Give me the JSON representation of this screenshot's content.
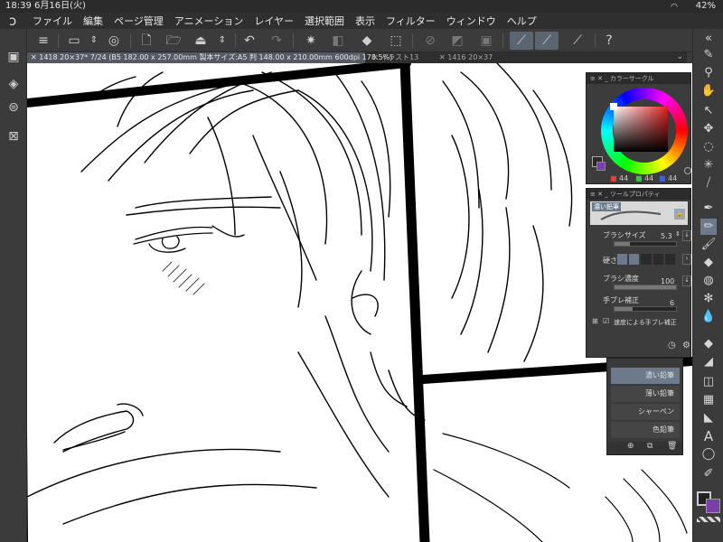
{
  "statusbar": {
    "time": "18:39",
    "date": "6月16日(火)",
    "battery": "42%"
  },
  "menu": [
    "ファイル",
    "編集",
    "ページ管理",
    "アニメーション",
    "レイヤー",
    "選択範囲",
    "表示",
    "フィルター",
    "ウィンドウ",
    "ヘルプ"
  ],
  "tabs": [
    "✕ 1418 20×37* 7/24 (B5 182.00 x 257.00mm 製本サイズ:A5 判 148.00 x 210.00mm 600dpi 178.5%)",
    "✕ イラスト13",
    "✕ 1416 20×37"
  ],
  "colorpanel": {
    "title": "カラーサークル",
    "r": "44",
    "g": "44",
    "b": "44"
  },
  "toolprop": {
    "title": "ツールプロパティ",
    "brush_name": "濃い鉛筆",
    "brush_size_label": "ブラシサイズ",
    "brush_size": "5.3",
    "hardness_label": "硬さ",
    "density_label": "ブラシ濃度",
    "density": "100",
    "stabilization_label": "手ブレ補正",
    "stabilization": "6",
    "speed_stab_label": "速度による手ブレ補正"
  },
  "brushlist": {
    "items": [
      "濃い鉛筆",
      "薄い鉛筆",
      "シャーペン",
      "色鉛筆"
    ]
  },
  "colors": {
    "chrome": "#3b3b3b",
    "accent": "#6d7a8c",
    "canvas": "#ffffff"
  }
}
